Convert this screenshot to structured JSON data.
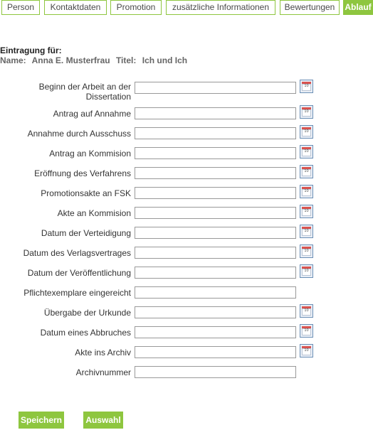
{
  "tabs": [
    "Person",
    "Kontaktdaten",
    "Promotion",
    "zusätzliche Informationen",
    "Bewertungen",
    "Ablauf"
  ],
  "header": {
    "title": "Eintragung für:",
    "name_label": "Name:",
    "name_value": "Anna E.  Musterfrau",
    "title_label": "Titel:",
    "title_value": "Ich und Ich"
  },
  "calendar_icon_text": "10",
  "fields": [
    {
      "label": "Beginn der Arbeit an der Dissertation",
      "value": "",
      "calendar": true
    },
    {
      "label": "Antrag auf Annahme",
      "value": "",
      "calendar": true
    },
    {
      "label": "Annahme durch Ausschuss",
      "value": "",
      "calendar": true
    },
    {
      "label": "Antrag an Kommision",
      "value": "",
      "calendar": true
    },
    {
      "label": "Eröffnung des Verfahrens",
      "value": "",
      "calendar": true
    },
    {
      "label": "Promotionsakte an FSK",
      "value": "",
      "calendar": true
    },
    {
      "label": "Akte an Kommision",
      "value": "",
      "calendar": true
    },
    {
      "label": "Datum der Verteidigung",
      "value": "",
      "calendar": true
    },
    {
      "label": "Datum des Verlagsvertrages",
      "value": "",
      "calendar": true
    },
    {
      "label": "Datum der Veröffentlichung",
      "value": "",
      "calendar": true
    },
    {
      "label": "Pflichtexemplare eingereicht",
      "value": "",
      "calendar": false
    },
    {
      "label": "Übergabe der Urkunde",
      "value": "",
      "calendar": true
    },
    {
      "label": "Datum eines Abbruches",
      "value": "",
      "calendar": true
    },
    {
      "label": "Akte ins Archiv",
      "value": "",
      "calendar": true
    },
    {
      "label": "Archivnummer",
      "value": "",
      "calendar": false
    }
  ],
  "buttons": {
    "save": "Speichern",
    "select": "Auswahl"
  },
  "colors": {
    "accent": "#8ec63f"
  }
}
